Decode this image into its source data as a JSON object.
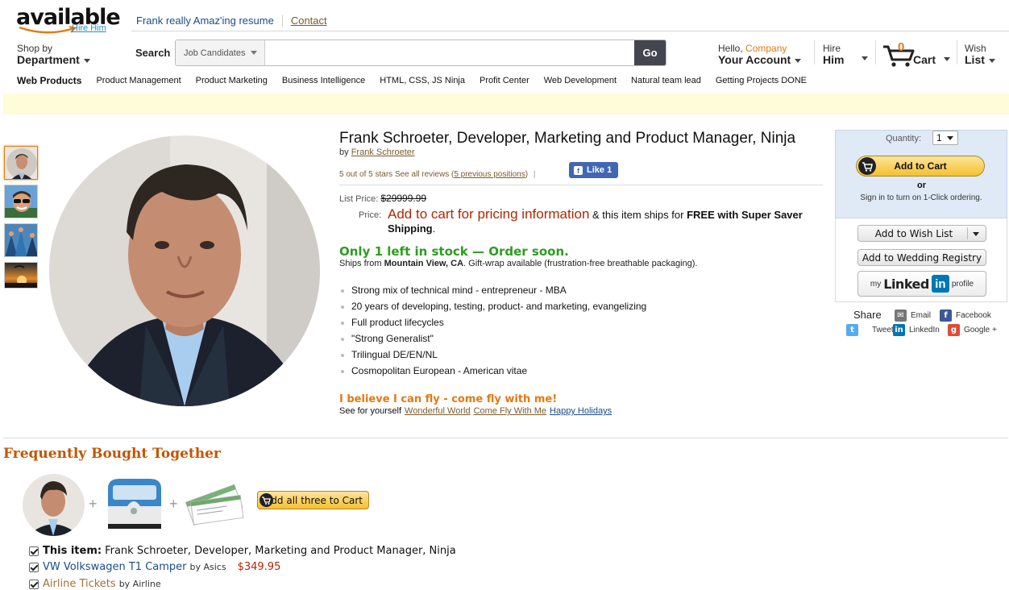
{
  "header": {
    "logo_text": "available",
    "logo_tag": "Hire Him",
    "top_links": [
      "Frank really Amaz'ing resume",
      "Contact"
    ],
    "shop_by": {
      "line1": "Shop by",
      "line2": "Department"
    },
    "search": {
      "label": "Search",
      "category": "Job Candidates",
      "placeholder": "",
      "value": "",
      "button": "Go"
    },
    "account": {
      "hello": "Hello,",
      "company": "Company",
      "label": "Your Account"
    },
    "hire": {
      "line1": "Hire",
      "line2": "Him"
    },
    "cart": {
      "count": "0",
      "label": "Cart"
    },
    "wish": {
      "line1": "Wish",
      "line2": "List"
    }
  },
  "nav": {
    "first": "Web Products",
    "items": [
      "Product Management",
      "Product Marketing",
      "Business Intelligence",
      "HTML, CSS, JS Ninja",
      "Profit Center",
      "Web Development",
      "Natural team lead",
      "Getting Projects DONE"
    ]
  },
  "product": {
    "title": "Frank Schroeter, Developer, Marketing and Product Manager, Ninja",
    "by": "by",
    "author": "Frank Schroeter",
    "rating_text": "5 out of 5 stars",
    "reviews_link": "See all reviews",
    "positions_link": "5 previous positions",
    "like_label": "Like 1",
    "list_price_label": "List Price:",
    "list_price": "$29999.99",
    "price_label": "Price:",
    "price_red": "Add to cart for pricing information",
    "price_mid": " & this item ships for ",
    "price_bold": "FREE with Super Saver Shipping",
    "price_end": ".",
    "stock": "Only 1 left in stock — Order soon.",
    "ships_pre": "Ships from ",
    "ships_loc": "Mountain View, CA",
    "ships_post": ". Gift-wrap available (frustration-free breathable packaging).",
    "bullets": [
      "Strong mix of technical mind - entrepreneur - MBA",
      "20 years of developing, testing, product- and marketing, evangelizing",
      "Full product lifecycles",
      "\"Strong Generalist\"",
      "Trilingual DE/EN/NL",
      "Cosmopolitan European - American vitae"
    ],
    "fly": "I believe I can fly - come fly with me!",
    "see_yourself": "See for yourself",
    "see_links": [
      "Wonderful World",
      "Come Fly With Me",
      "Happy Holidays"
    ]
  },
  "buybox": {
    "quantity_label": "Quantity:",
    "quantity": "1",
    "add_to_cart": "Add to Cart",
    "or": "or",
    "signin": "Sign in to turn on 1-Click ordering.",
    "wish_list": "Add to Wish List",
    "wedding": "Add to Wedding Registry",
    "linkedin": {
      "my": "my",
      "linked": "Linked",
      "in": "in",
      "profile": "profile"
    }
  },
  "share": {
    "title": "Share",
    "items": [
      "Email",
      "Facebook",
      "Tweet",
      "LinkedIn",
      "Google +"
    ]
  },
  "fbt": {
    "title": "Frequently Bought Together",
    "button": "Add all three to Cart",
    "rows": [
      {
        "bold": "This item:",
        "text": "Frank Schroeter, Developer, Marketing and Product Manager, Ninja"
      },
      {
        "text": "VW Volkswagen T1 Camper",
        "by": "by Asics",
        "price": "$349.95"
      },
      {
        "text": "Airline Tickets",
        "by": "by Airline"
      }
    ]
  },
  "colors": {
    "accent_orange": "#e47911",
    "stock_green": "#2e9c22",
    "price_red": "#b12704",
    "link_brown": "#7a5b2a"
  }
}
